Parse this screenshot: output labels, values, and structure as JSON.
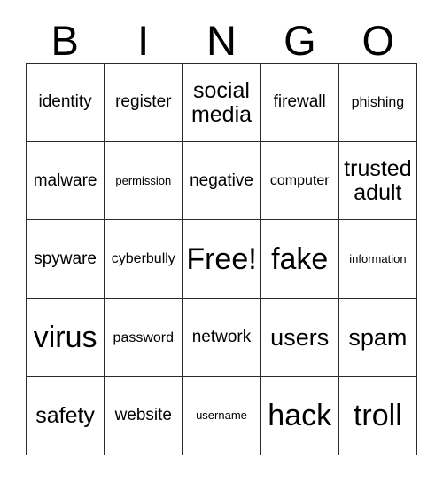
{
  "card": {
    "title": "BINGO",
    "header_letters": [
      "B",
      "I",
      "N",
      "G",
      "O"
    ],
    "grid_size": 5,
    "colors": {
      "background": "#ffffff",
      "border": "#2b2b2b",
      "text": "#000000"
    },
    "cells": [
      {
        "text": "identity",
        "size": "size-sm",
        "row": 1,
        "col": 1
      },
      {
        "text": "register",
        "size": "size-sm",
        "row": 1,
        "col": 2
      },
      {
        "text": "social media",
        "size": "size-md",
        "row": 1,
        "col": 3
      },
      {
        "text": "firewall",
        "size": "size-sm",
        "row": 1,
        "col": 4
      },
      {
        "text": "phishing",
        "size": "size-xs",
        "row": 1,
        "col": 5
      },
      {
        "text": "malware",
        "size": "size-sm",
        "row": 2,
        "col": 1
      },
      {
        "text": "permission",
        "size": "size-xxs",
        "row": 2,
        "col": 2
      },
      {
        "text": "negative",
        "size": "size-sm",
        "row": 2,
        "col": 3
      },
      {
        "text": "computer",
        "size": "size-xs",
        "row": 2,
        "col": 4
      },
      {
        "text": "trusted adult",
        "size": "size-md",
        "row": 2,
        "col": 5
      },
      {
        "text": "spyware",
        "size": "size-sm",
        "row": 3,
        "col": 1
      },
      {
        "text": "cyberbully",
        "size": "size-xs",
        "row": 3,
        "col": 2
      },
      {
        "text": "Free!",
        "size": "size-xl",
        "row": 3,
        "col": 3
      },
      {
        "text": "fake",
        "size": "size-xl",
        "row": 3,
        "col": 4
      },
      {
        "text": "information",
        "size": "size-xxs",
        "row": 3,
        "col": 5
      },
      {
        "text": "virus",
        "size": "size-xl",
        "row": 4,
        "col": 1
      },
      {
        "text": "password",
        "size": "size-xs",
        "row": 4,
        "col": 2
      },
      {
        "text": "network",
        "size": "size-sm",
        "row": 4,
        "col": 3
      },
      {
        "text": "users",
        "size": "size-lg",
        "row": 4,
        "col": 4
      },
      {
        "text": "spam",
        "size": "size-lg",
        "row": 4,
        "col": 5
      },
      {
        "text": "safety",
        "size": "size-md",
        "row": 5,
        "col": 1
      },
      {
        "text": "website",
        "size": "size-sm",
        "row": 5,
        "col": 2
      },
      {
        "text": "username",
        "size": "size-xxs",
        "row": 5,
        "col": 3
      },
      {
        "text": "hack",
        "size": "size-xl",
        "row": 5,
        "col": 4
      },
      {
        "text": "troll",
        "size": "size-xl",
        "row": 5,
        "col": 5
      }
    ]
  }
}
